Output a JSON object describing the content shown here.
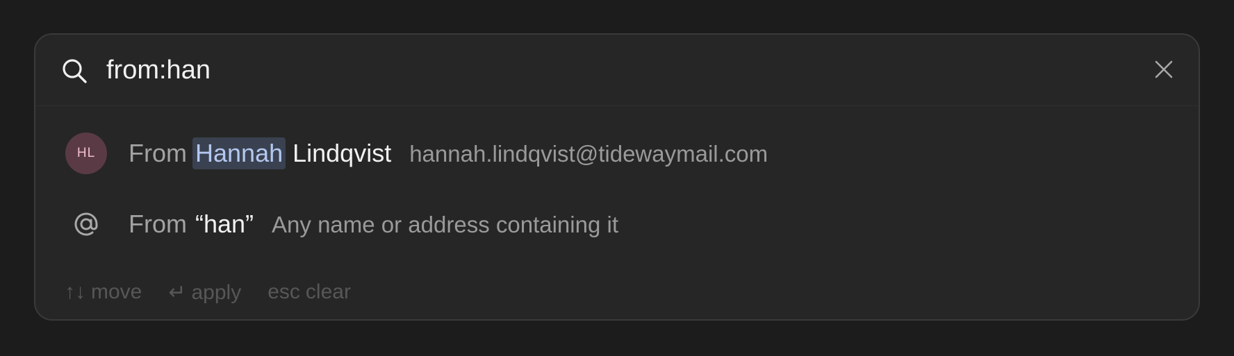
{
  "search": {
    "query": "from:han",
    "icon": "search-icon",
    "clear_icon": "close-icon"
  },
  "suggestions": [
    {
      "avatar_initials": "HL",
      "prefix": "From",
      "match": "Hannah",
      "rest": "Lindqvist",
      "detail": "hannah.lindqvist@tidewaymail.com"
    },
    {
      "icon": "at-sign-icon",
      "prefix": "From",
      "term": "“han”",
      "detail": "Any name or address containing it"
    }
  ],
  "footer": {
    "move_key": "↑↓",
    "move_label": "move",
    "apply_key": "↵",
    "apply_label": "apply",
    "clear_key": "esc",
    "clear_label": "clear"
  },
  "colors": {
    "background": "#1c1c1c",
    "panel": "#262626",
    "highlight_bg": "#3a4150",
    "highlight_text": "#b4c8f0",
    "avatar_bg": "#5a3b45",
    "avatar_text": "#f1bfcf"
  }
}
